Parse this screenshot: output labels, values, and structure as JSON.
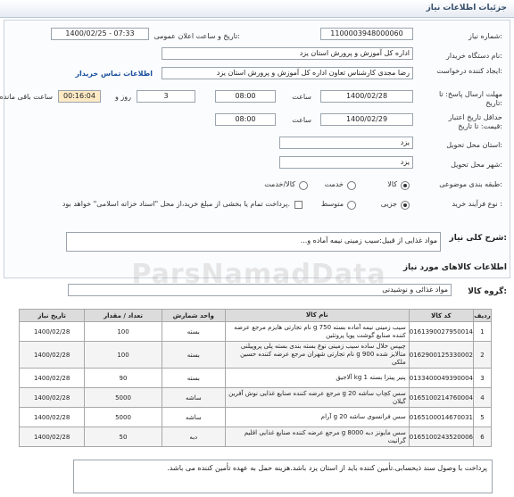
{
  "window": {
    "title": "جزئیات اطلاعات نیاز"
  },
  "fields": {
    "need_number_label": "شماره نیاز:",
    "need_number": "1100003948000060",
    "announce_label": "تاریخ و ساعت اعلان عمومی:",
    "announce_value": "1400/02/25 - 07:33",
    "buyer_label": "نام دستگاه خریدار:",
    "buyer": "اداره کل آموزش و پرورش استان یزد",
    "creator_label": "ایجاد کننده درخواست:",
    "creator": "رضا مجدی کارشناس تعاون اداره کل آموزش و پرورش استان یزد",
    "contact_link": "اطلاعات تماس خریدار",
    "reply_deadline_label": "مهلت ارسال پاسخ: تا تاریخ:",
    "reply_date": "1400/02/28",
    "time_label": "ساعت",
    "reply_time": "08:00",
    "days": "3",
    "days_label": "روز و",
    "remaining": "00:16:04",
    "remaining_label": "ساعت باقی مانده",
    "validity_label": "حداقل تاریخ اعتبار قیمت: تا تاریخ:",
    "validity_date": "1400/02/29",
    "validity_time": "08:00",
    "province_label": "استان محل تحویل:",
    "province": "یزد",
    "city_label": "شهر محل تحویل:",
    "city": "یزد",
    "category_label": "طبقه بندی موضوعی:",
    "category_options": [
      "کالا",
      "خدمت",
      "کالا/خدمت"
    ],
    "process_label": "نوع فرآیند خرید :",
    "process_options": [
      "جزیی",
      "متوسط"
    ],
    "treasury_note": "پرداخت تمام یا بخشی از مبلغ خرید،از محل \"اسناد خزانه اسلامی\" خواهد بود."
  },
  "summary": {
    "label": "شرح کلی نیاز:",
    "value": "مواد غذایی از قبیل:سیب زمینی نیمه آماده و..."
  },
  "goods_section": {
    "title": "اطلاعات کالاهای مورد نیاز"
  },
  "group": {
    "label": "گروه کالا:",
    "value": "مواد غذائی و نوشیدنی"
  },
  "table": {
    "headers": [
      "ردیف",
      "کد کالا",
      "نام کالا",
      "واحد شمارش",
      "تعداد / مقدار",
      "تاریخ نیاز"
    ],
    "rows": [
      [
        "1",
        "0161390027950014",
        "سیب زمینی نیمه آماده بسته 750 g نام تجارتی هایزم مرجع عرضه کننده صنایع گوشت پویا پروتئین",
        "بسته",
        "100",
        "1400/02/28"
      ],
      [
        "2",
        "0162900125330002",
        "چیپس خلال ساده سیب زمینی نوع بسته بندی بسته پلی پروپیلنی متالایز شده 900 g نام تجارتی شهران مرجع عرضه کننده حسین ملکی",
        "بسته",
        "100",
        "1400/02/28"
      ],
      [
        "3",
        "0133400049390004",
        "پنیر پیتزا بسته 1 kg آلاجیق",
        "بسته",
        "90",
        "1400/02/28"
      ],
      [
        "4",
        "0165100214760004",
        "سس کچاپ ساشه 20 g مرجع عرضه کننده صنایع غذایی نوش آفرین گیلان",
        "ساشه",
        "5000",
        "1400/02/28"
      ],
      [
        "5",
        "0165100014670031",
        "سس فرانسوی ساشه 20 g آرام",
        "ساشه",
        "5000",
        "1400/02/28"
      ],
      [
        "6",
        "0165100243520006",
        "سس مایونز دبه 8000 g مرجع عرضه کننده صنایع غذایی اقلیم گرانیت",
        "دبه",
        "50",
        "1400/02/28"
      ]
    ]
  },
  "note": "پرداخت با وصول سند ذیحسابی.تأمین کننده باید از استان یزد باشد.هزینه حمل به عهده تأمین کننده می باشد.",
  "watermark": "ParsNamadData"
}
